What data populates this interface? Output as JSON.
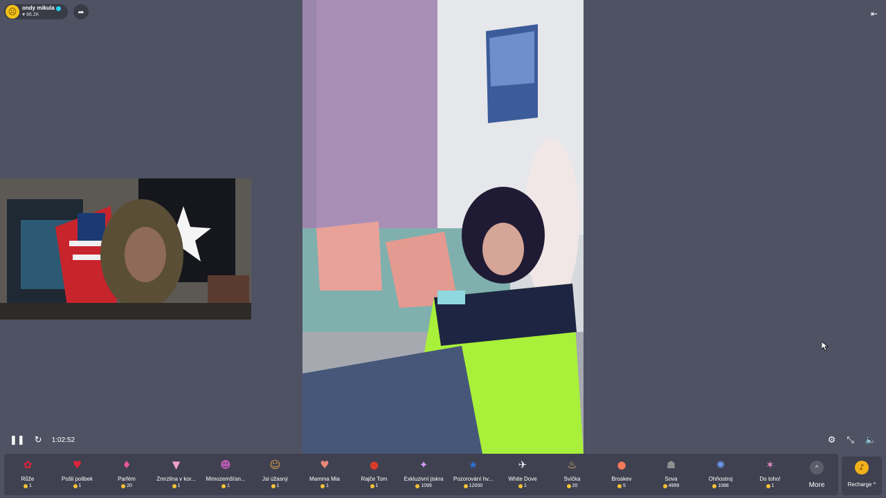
{
  "streamer": {
    "name": "ondy mikula",
    "likes": "86.2K"
  },
  "player": {
    "time": "1:02:52"
  },
  "icons": {
    "pause": "pause-icon",
    "refresh": "refresh-icon",
    "settings": "settings-icon",
    "minimize": "minimize-icon",
    "volume": "volume-icon",
    "share": "share-icon",
    "exit": "exit-icon"
  },
  "gifts": [
    {
      "name": "Růže",
      "price": "1",
      "icon": "rose-icon",
      "color": "#e5223b",
      "glyph": "✿"
    },
    {
      "name": "Pošli polibek",
      "price": "1",
      "icon": "lips-icon",
      "color": "#e0243c",
      "glyph": "♥"
    },
    {
      "name": "Parfém",
      "price": "20",
      "icon": "perfume-icon",
      "color": "#e6559a",
      "glyph": "♦"
    },
    {
      "name": "Zmrzlina v kor...",
      "price": "1",
      "icon": "ice-cream-icon",
      "color": "#f0a0c8",
      "glyph": "▼"
    },
    {
      "name": "Mimozemšťan...",
      "price": "1",
      "icon": "alien-icon",
      "color": "#b55bb0",
      "glyph": "☻"
    },
    {
      "name": "Jsi úžasný",
      "price": "1",
      "icon": "cat-icon",
      "color": "#e9a64a",
      "glyph": "☺"
    },
    {
      "name": "Mamma Mia",
      "price": "1",
      "icon": "heart-icon",
      "color": "#e8877a",
      "glyph": "♥"
    },
    {
      "name": "Rajče Tom",
      "price": "1",
      "icon": "tomato-icon",
      "color": "#d93a2a",
      "glyph": "●"
    },
    {
      "name": "Exkluzivní jiskra",
      "price": "1099",
      "icon": "spark-icon",
      "color": "#d49cf0",
      "glyph": "✦"
    },
    {
      "name": "Pozorování hv...",
      "price": "12000",
      "icon": "star-gazing-icon",
      "color": "#2a6fd6",
      "glyph": "★"
    },
    {
      "name": "White Dove",
      "price": "1",
      "icon": "dove-icon",
      "color": "#e8e8ee",
      "glyph": "✈"
    },
    {
      "name": "Svíčka",
      "price": "20",
      "icon": "candle-icon",
      "color": "#f3c36a",
      "glyph": "♨"
    },
    {
      "name": "Broskev",
      "price": "5",
      "icon": "peach-icon",
      "color": "#f27a5a",
      "glyph": "●"
    },
    {
      "name": "Sova",
      "price": "4999",
      "icon": "owl-icon",
      "color": "#8a8f90",
      "glyph": "☗"
    },
    {
      "name": "Ohňostroj",
      "price": "1088",
      "icon": "fireworks-icon",
      "color": "#6a9af0",
      "glyph": "✺"
    },
    {
      "name": "Do toho!",
      "price": "1",
      "icon": "lollipop-icon",
      "color": "#e68ac8",
      "glyph": "✶"
    }
  ],
  "more": {
    "label": "More"
  },
  "recharge": {
    "label": "Recharge ^"
  }
}
